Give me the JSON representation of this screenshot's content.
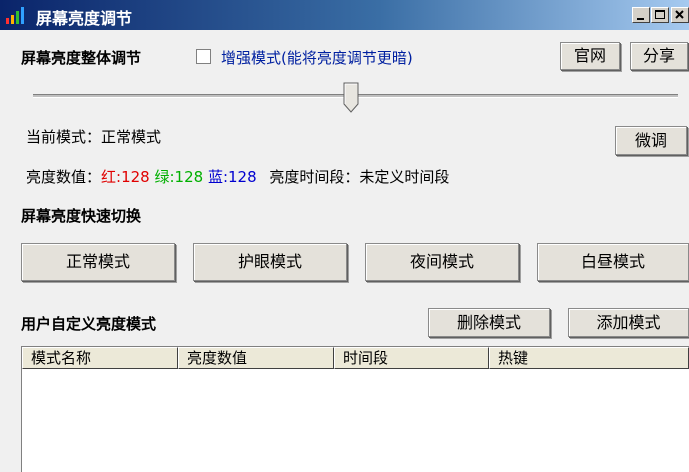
{
  "window": {
    "title": "屏幕亮度调节"
  },
  "brightness": {
    "section_title": "屏幕亮度整体调节",
    "enhance_label": "增强模式(能将亮度调节更暗)",
    "enhance_checked": false,
    "slider_level": 0.5
  },
  "header_buttons": {
    "official": "官网",
    "share": "分享"
  },
  "status": {
    "mode_text": "当前模式：正常模式",
    "fine_tune": "微调",
    "value_label": "亮度数值：",
    "red": "红:128",
    "green": "绿:128",
    "blue": "蓝:128",
    "period_text": "亮度时间段：未定义时间段"
  },
  "colors": {
    "red": "#e00000",
    "green": "#00b000",
    "blue": "#0000d0",
    "link": "#0020a0"
  },
  "quick": {
    "section_title": "屏幕亮度快速切换",
    "buttons": [
      "正常模式",
      "护眼模式",
      "夜间模式",
      "白昼模式"
    ]
  },
  "custom": {
    "section_title": "用户自定义亮度模式",
    "delete": "删除模式",
    "add": "添加模式",
    "columns": [
      "模式名称",
      "亮度数值",
      "时间段",
      "热键"
    ]
  }
}
